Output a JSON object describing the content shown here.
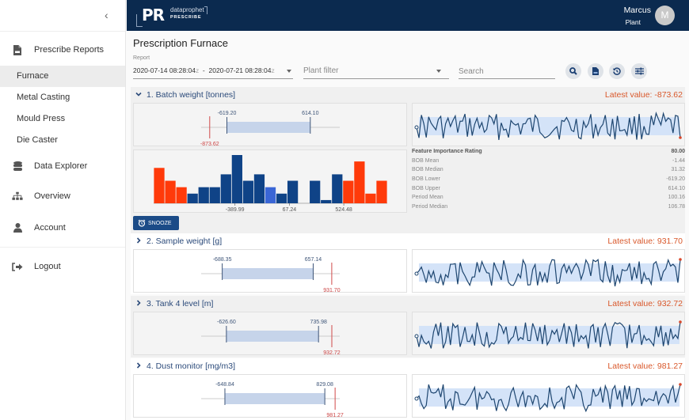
{
  "sidebar": {
    "collapse_icon": "chevron-left-icon",
    "items": [
      {
        "label": "Prescribe Reports",
        "icon": "report-file-icon"
      },
      {
        "label": "Data Explorer",
        "icon": "database-icon"
      },
      {
        "label": "Overview",
        "icon": "sitemap-icon"
      },
      {
        "label": "Account",
        "icon": "user-icon"
      },
      {
        "label": "Logout",
        "icon": "logout-icon"
      }
    ],
    "sub_items": [
      {
        "label": "Furnace",
        "active": true
      },
      {
        "label": "Metal Casting",
        "active": false
      },
      {
        "label": "Mould Press",
        "active": false
      },
      {
        "label": "Die Caster",
        "active": false
      }
    ]
  },
  "topbar": {
    "logo_mark": "PR",
    "logo_brand": "dataprophet",
    "logo_product": "PRESCRIBE",
    "user_name": "Marcus",
    "user_role": "Plant",
    "avatar_initial": "M"
  },
  "page": {
    "title": "Prescription Furnace",
    "report_label": "Report",
    "date_from": "2020-07-14  08:28:04",
    "date_to": "2020-07-21  08:28:04",
    "date_suffix": "z",
    "date_sep": "-",
    "plant_filter_placeholder": "Plant filter",
    "search_placeholder": "Search",
    "toolbar_icons": [
      "search-icon",
      "csv-file-icon",
      "history-icon",
      "sliders-icon"
    ]
  },
  "colors": {
    "brand_navy": "#0b2a4f",
    "accent_blue": "#1b4b87",
    "bar_blue": "#0f4387",
    "bar_highlight": "#3a66d6",
    "bar_red": "#ff3a0a",
    "latest_red": "#d9582b"
  },
  "sections": [
    {
      "title": "1. Batch weight [tonnes]",
      "expanded": true,
      "latest_label": "Latest value: -873.62",
      "bob_lower": -619.2,
      "bob_upper": 614.1,
      "latest": -873.62,
      "bob_lower_label": "-619.20",
      "bob_upper_label": "614.10",
      "latest_value_label": "-873.62",
      "snooze_label": "SNOOZE",
      "histogram": {
        "counts": [
          5.5,
          3.5,
          2.5,
          1.5,
          2.5,
          2.5,
          4.5,
          7.5,
          3.5,
          4.5,
          2.5,
          1.5,
          3.5,
          0,
          3.5,
          0.5,
          4.5,
          3.5,
          6.5,
          1.5,
          3.5
        ],
        "colors": [
          "red",
          "red",
          "red",
          "blue",
          "blue",
          "blue",
          "blue",
          "blue",
          "blue",
          "blue",
          "highlight",
          "blue",
          "blue",
          "blue",
          "blue",
          "blue",
          "blue",
          "red",
          "red",
          "red",
          "red"
        ],
        "tick_labels": [
          "-389.99",
          "67.24",
          "524.48"
        ]
      },
      "stats": [
        {
          "key": "Feature Importance Rating",
          "value": "80.00",
          "bold": true
        },
        {
          "key": "BOB Mean",
          "value": "-1.44"
        },
        {
          "key": "BOB Median",
          "value": "31.32"
        },
        {
          "key": "BOB Lower",
          "value": "-619.20"
        },
        {
          "key": "BOB Upper",
          "value": "614.10"
        },
        {
          "key": "Period Mean",
          "value": "100.16"
        },
        {
          "key": "Period Median",
          "value": "106.78"
        }
      ],
      "trend_end": "low"
    },
    {
      "title": "2. Sample weight [g]",
      "expanded": false,
      "latest_label": "Latest value: 931.70",
      "bob_lower": -688.35,
      "bob_upper": 657.14,
      "latest": 931.7,
      "bob_lower_label": "-688.35",
      "bob_upper_label": "657.14",
      "latest_value_label": "931.70",
      "trend_end": "high"
    },
    {
      "title": "3. Tank 4 level [m]",
      "expanded": false,
      "latest_label": "Latest value: 932.72",
      "bob_lower": -626.6,
      "bob_upper": 735.98,
      "latest": 932.72,
      "bob_lower_label": "-626.60",
      "bob_upper_label": "735.98",
      "latest_value_label": "932.72",
      "trend_end": "high"
    },
    {
      "title": "4. Dust monitor [mg/m3]",
      "expanded": false,
      "latest_label": "Latest value: 981.27",
      "bob_lower": -648.84,
      "bob_upper": 829.08,
      "latest": 981.27,
      "bob_lower_label": "-648.84",
      "bob_upper_label": "829.08",
      "latest_value_label": "981.27",
      "trend_end": "high"
    }
  ]
}
